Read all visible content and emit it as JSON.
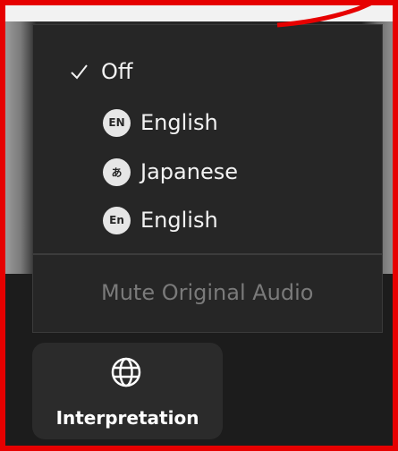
{
  "menu": {
    "items": [
      {
        "label": "Off",
        "checked": true,
        "icon": "check-icon"
      },
      {
        "label": "English",
        "badge": "EN",
        "icon": "language-badge-icon"
      },
      {
        "label": "Japanese",
        "badge": "あ",
        "icon": "language-badge-icon"
      },
      {
        "label": "English",
        "badge": "En",
        "icon": "language-badge-icon"
      }
    ],
    "mute_label": "Mute Original Audio"
  },
  "toolbar": {
    "interpretation_label": "Interpretation",
    "interpretation_icon": "globe-icon"
  },
  "colors": {
    "annotation": "#e60000",
    "menu_bg": "#262626",
    "text": "#f2f2f2",
    "disabled_text": "#7a7a7a"
  }
}
